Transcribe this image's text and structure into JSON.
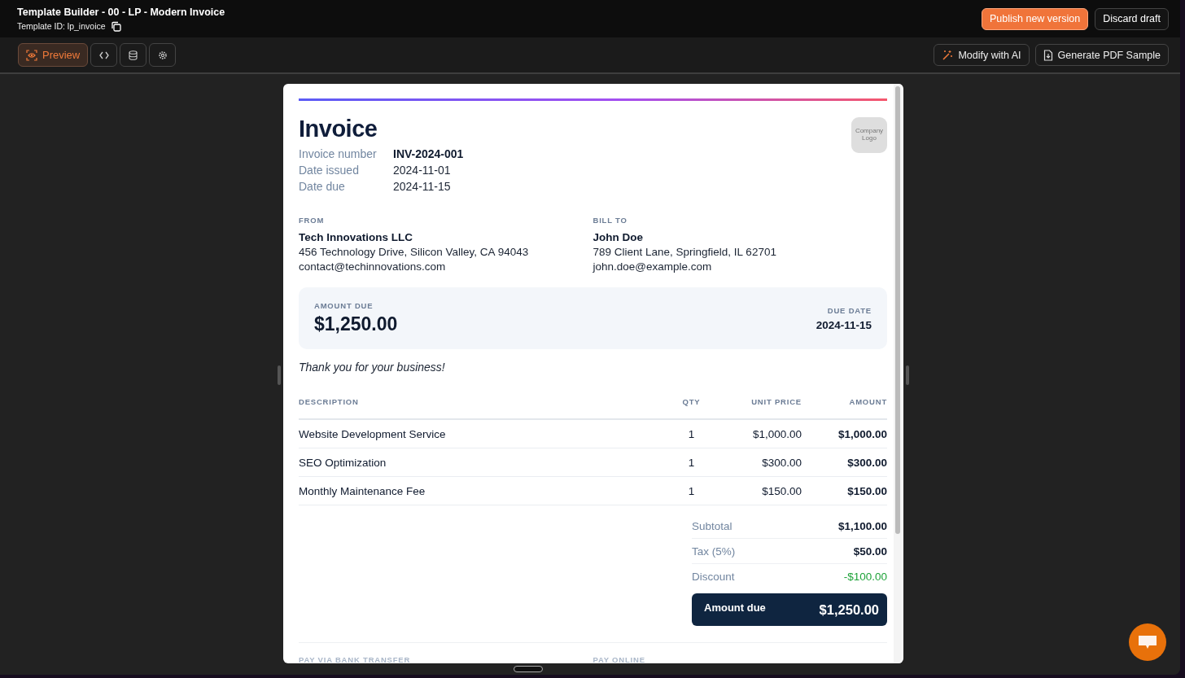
{
  "header": {
    "title": "Template Builder - 00 - LP - Modern Invoice",
    "template_id": "Template ID: lp_invoice",
    "buttons": [
      {
        "label": "Publish new version",
        "kind": "primary"
      },
      {
        "label": "Discard draft",
        "kind": "secondary"
      }
    ]
  },
  "toolbar": {
    "tabs": [
      {
        "kind": "preview",
        "label": "Preview",
        "selected": true
      },
      {
        "kind": "code",
        "selected": false
      },
      {
        "kind": "data",
        "selected": false
      },
      {
        "kind": "settings",
        "selected": false
      }
    ],
    "actions": [
      {
        "kind": "ai",
        "label": "Modify with AI"
      },
      {
        "kind": "pdf",
        "label": "Generate PDF Sample"
      }
    ]
  },
  "invoice": {
    "title": "Invoice",
    "logo": "Company Logo",
    "meta": [
      {
        "label": "Invoice number",
        "value": "INV-2024-001",
        "bold": true
      },
      {
        "label": "Date issued",
        "value": "2024-11-01",
        "bold": false
      },
      {
        "label": "Date due",
        "value": "2024-11-15",
        "bold": false
      }
    ],
    "parties": [
      {
        "heading": "FROM",
        "name": "Tech Innovations LLC",
        "address": "456 Technology Drive, Silicon Valley, CA 94043",
        "email": "contact@techinnovations.com"
      },
      {
        "heading": "BILL TO",
        "name": "John Doe",
        "address": "789 Client Lane, Springfield, IL 62701",
        "email": "john.doe@example.com"
      }
    ],
    "summary": {
      "amount_label": "AMOUNT DUE",
      "amount": "$1,250.00",
      "due_label": "DUE DATE",
      "due_date": "2024-11-15"
    },
    "note": "Thank you for your business!",
    "table": {
      "columns": [
        "DESCRIPTION",
        "QTY",
        "UNIT PRICE",
        "AMOUNT"
      ],
      "rows": [
        [
          "Website Development Service",
          "1",
          "$1,000.00",
          "$1,000.00"
        ],
        [
          "SEO Optimization",
          "1",
          "$300.00",
          "$300.00"
        ],
        [
          "Monthly Maintenance Fee",
          "1",
          "$150.00",
          "$150.00"
        ]
      ]
    },
    "totals": [
      {
        "label": "Subtotal",
        "value": "$1,100.00",
        "kind": "normal"
      },
      {
        "label": "Tax (5%)",
        "value": "$50.00",
        "kind": "normal"
      },
      {
        "label": "Discount",
        "value": "-$100.00",
        "kind": "discount"
      }
    ],
    "total_due": {
      "label": "Amount due",
      "value": "$1,250.00"
    },
    "payment_headings": [
      "PAY VIA BANK TRANSFER",
      "PAY ONLINE"
    ]
  }
}
